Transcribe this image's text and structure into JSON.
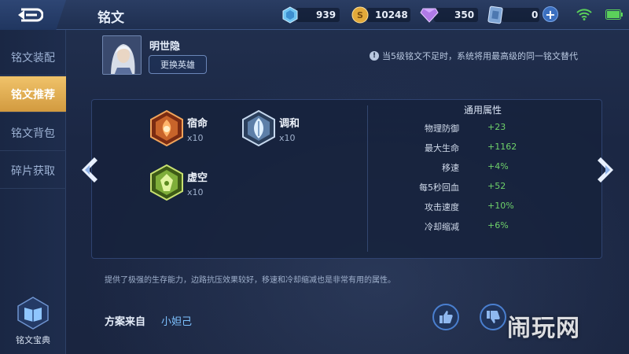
{
  "header": {
    "title": "铭文",
    "resources": {
      "crystal": "939",
      "gold": "10248",
      "diamond": "350",
      "coupon": "0"
    },
    "add_label": "+"
  },
  "sidebar": {
    "items": [
      {
        "label": "铭文装配"
      },
      {
        "label": "铭文推荐"
      },
      {
        "label": "铭文背包"
      },
      {
        "label": "碎片获取"
      }
    ],
    "codex_label": "铭文宝典"
  },
  "hero": {
    "name": "明世隐",
    "change_label": "更换英雄"
  },
  "notice": "当5级铭文不足时，系统将用最高级的同一铭文替代",
  "runes": [
    {
      "name": "宿命",
      "count": "x10",
      "color": "#c8642a"
    },
    {
      "name": "调和",
      "count": "x10",
      "color": "#7fa2c8"
    },
    {
      "name": "虚空",
      "count": "x10",
      "color": "#7fae3a"
    }
  ],
  "attributes": {
    "title": "通用属性",
    "rows": [
      {
        "name": "物理防御",
        "value": "+23"
      },
      {
        "name": "最大生命",
        "value": "+1162"
      },
      {
        "name": "移速",
        "value": "+4%"
      },
      {
        "name": "每5秒回血",
        "value": "+52"
      },
      {
        "name": "攻击速度",
        "value": "+10%"
      },
      {
        "name": "冷却缩减",
        "value": "+6%"
      }
    ]
  },
  "description": "提供了极强的生存能力，边路抗压效果较好，移速和冷却缩减也是非常有用的属性。",
  "source": {
    "label": "方案来自",
    "author": "小妲己"
  },
  "watermark": "闹玩网",
  "colors": {
    "accent_gold": "#e0ad55",
    "positive_green": "#6fd26a",
    "link_blue": "#7ec2ff"
  }
}
